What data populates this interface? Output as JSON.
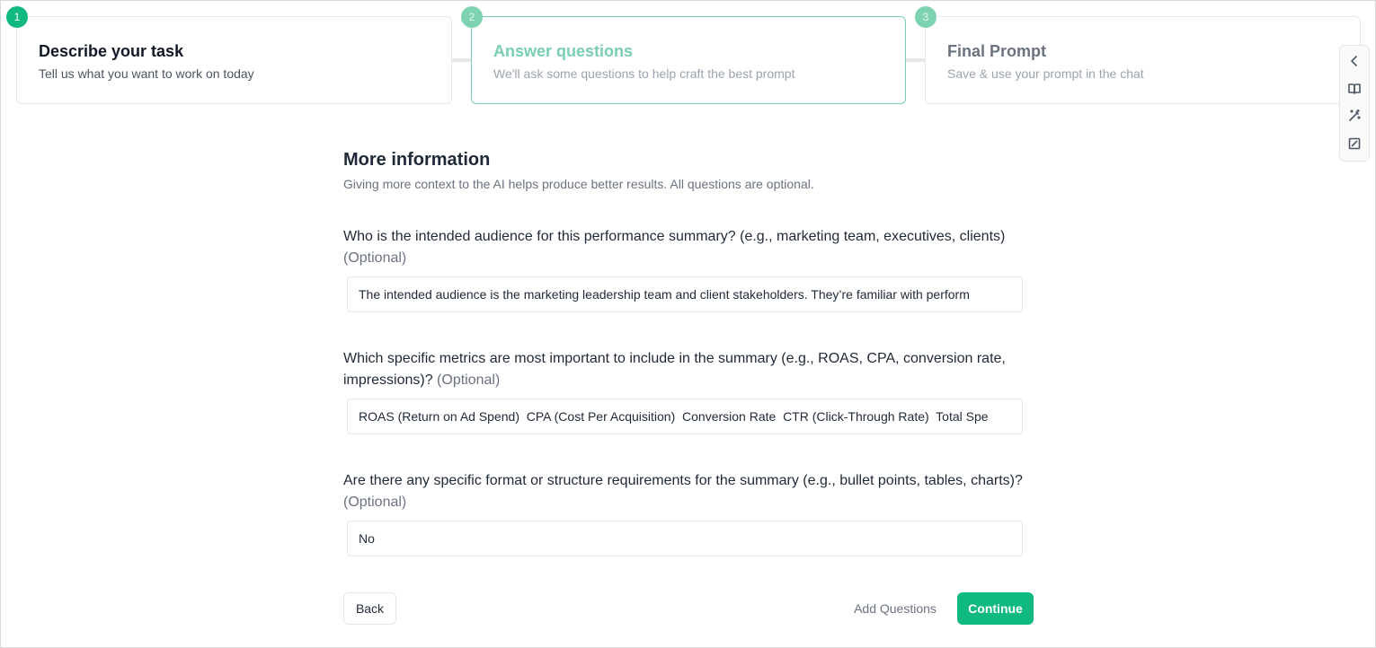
{
  "steps": [
    {
      "number": "1",
      "title": "Describe your task",
      "subtitle": "Tell us what you want to work on today",
      "state": "completed"
    },
    {
      "number": "2",
      "title": "Answer questions",
      "subtitle": "We'll ask some questions to help craft the best prompt",
      "state": "active"
    },
    {
      "number": "3",
      "title": "Final Prompt",
      "subtitle": "Save & use your prompt in the chat",
      "state": "upcoming"
    }
  ],
  "toolbar": {
    "icons": [
      "chevron-left-icon",
      "book-open-icon",
      "magic-wand-icon",
      "edit-square-icon"
    ]
  },
  "form": {
    "title": "More information",
    "description": "Giving more context to the AI helps produce better results. All questions are optional.",
    "optional_tag": "(Optional)",
    "questions": [
      {
        "label": "Who is the intended audience for this performance summary? (e.g., marketing team, executives, clients)",
        "value": "The intended audience is the marketing leadership team and client stakeholders. They’re familiar with perform"
      },
      {
        "label": "Which specific metrics are most important to include in the summary (e.g., ROAS, CPA, conversion rate, impressions)?",
        "value": "ROAS (Return on Ad Spend)  CPA (Cost Per Acquisition)  Conversion Rate  CTR (Click-Through Rate)  Total Spe"
      },
      {
        "label": "Are there any specific format or structure requirements for the summary (e.g., bullet points, tables, charts)?",
        "value": "No"
      }
    ]
  },
  "buttons": {
    "back": "Back",
    "add_questions": "Add Questions",
    "continue": "Continue"
  },
  "colors": {
    "accent": "#10b981",
    "accent_muted": "#7ccfb2",
    "border": "#e5e7eb",
    "text": "#1f2937",
    "muted_text": "#6b7280"
  }
}
